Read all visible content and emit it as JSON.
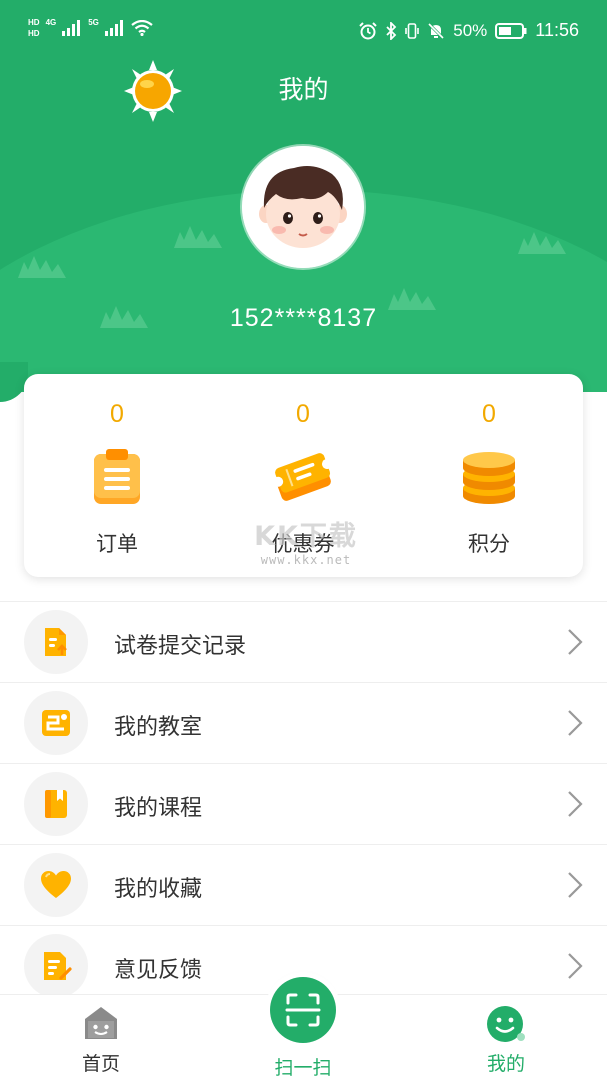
{
  "status_bar": {
    "left_badges": [
      "HD",
      "HD"
    ],
    "network_1": "4G",
    "network_2": "5G",
    "battery_percent": "50%",
    "time": "11:56"
  },
  "header": {
    "title": "我的",
    "phone": "152****8137"
  },
  "stats": [
    {
      "count": "0",
      "label": "订单",
      "icon": "clipboard-icon"
    },
    {
      "count": "0",
      "label": "优惠券",
      "icon": "ticket-icon"
    },
    {
      "count": "0",
      "label": "积分",
      "icon": "coins-icon"
    }
  ],
  "watermark": {
    "logo": "KK下载",
    "url": "www.kkx.net"
  },
  "menu": [
    {
      "label": "试卷提交记录",
      "icon": "document-upload-icon"
    },
    {
      "label": "我的教室",
      "icon": "classroom-icon"
    },
    {
      "label": "我的课程",
      "icon": "book-icon"
    },
    {
      "label": "我的收藏",
      "icon": "heart-icon"
    },
    {
      "label": "意见反馈",
      "icon": "feedback-icon"
    }
  ],
  "bottom_nav": {
    "home_label": "首页",
    "scan_label": "扫一扫",
    "mine_label": "我的"
  },
  "colors": {
    "brand_green": "#23ad69",
    "count_orange": "#f2a900",
    "icon_orange": "#ffb300"
  }
}
